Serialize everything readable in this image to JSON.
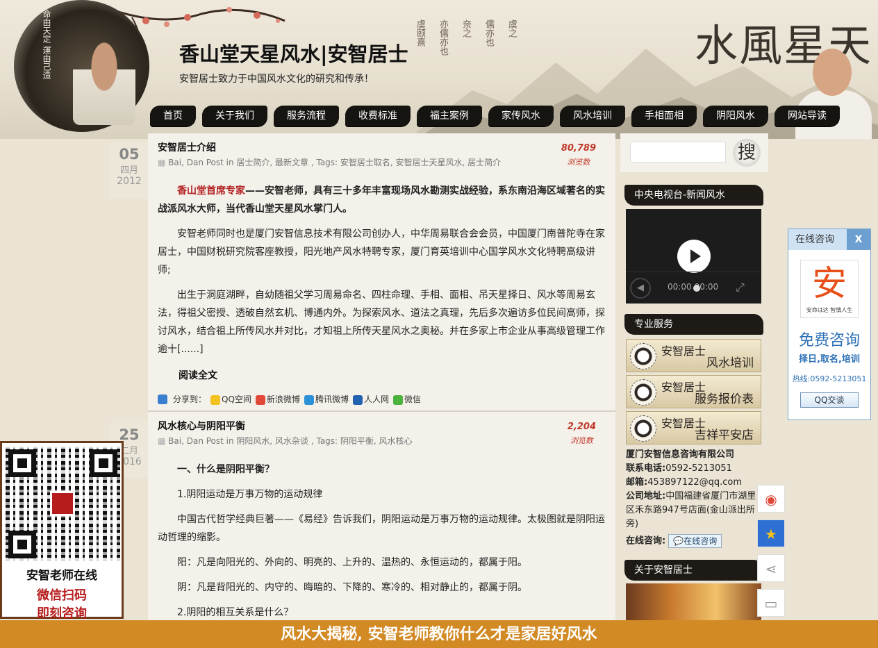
{
  "header": {
    "site_title": "香山堂天星风水|安智居士",
    "site_subtitle": "安智居士致力于中国风水文化的研究和传承！",
    "calligraphy_big": "水風星天",
    "poem_columns": [
      "虞颐熹",
      "亦儒亦也",
      "奈之",
      "儒亦也",
      "虞之"
    ],
    "left_calligraphy": "命由天定 運由己造"
  },
  "nav": {
    "items": [
      "首页",
      "关于我们",
      "服务流程",
      "收费标准",
      "福主案例",
      "家传风水",
      "风水培训",
      "手相面相",
      "阴阳风水",
      "网站导读"
    ]
  },
  "posts": [
    {
      "day": "05",
      "month": "四月",
      "year": "2012",
      "title": "安智居士介绍",
      "meta": "Bai, Dan Post in 居士简介, 最新文章 , Tags: 安智居士取名, 安智居士天星风水, 居士简介",
      "views": "80,789",
      "views_label": "浏览数",
      "lead_red": "香山堂首席专家",
      "lead_rest": "——安智老师，具有三十多年丰富现场风水勘测实战经验，系东南沿海区域著名的实战派风水大师，当代香山堂天星风水掌门人。",
      "p2": "安智老师同时也是厦门安智信息技术有限公司创办人，中华周易联合会会员，中国厦门南普陀寺在家居士，中国财税研究院客座教授，阳光地产风水特聘专家，厦门育英培训中心国学风水文化特聘高级讲师;",
      "p3": "出生于洞庭湖畔，自幼随祖父学习周易命名、四柱命理、手相、面相、吊天星择日、风水等周易玄法，得祖父密授、透破自然玄机、博通内外。为探索风水、道法之真理，先后多次遍访多位民间高师，探讨风水，结合祖上所传风水并对比，才知祖上所传天星风水之奥秘。并在多家上市企业从事高级管理工作逾十[......]",
      "read_more": "阅读全文",
      "share_label": "分享到：",
      "share_items": [
        "QQ空间",
        "新浪微博",
        "腾讯微博",
        "人人网",
        "微信"
      ]
    },
    {
      "day": "25",
      "month": "二月",
      "year": "2016",
      "title": "风水核心与阴阳平衡",
      "meta": "Bai, Dan Post in 阴阳风水, 风水杂谈 , Tags: 阴阳平衡, 风水核心",
      "views": "2,204",
      "views_label": "浏览数",
      "h1": "一、什么是阴阳平衡？",
      "h2": "1.阴阳运动是万事万物的运动规律",
      "p1": "中国古代哲学经典巨著——《易经》告诉我们，阴阳运动是万事万物的运动规律。太极图就是阴阳运动哲理的缩影。",
      "p2": "阳：凡是向阳光的、外向的、明亮的、上升的、温热的、永恒运动的，都属于阳。",
      "p3": "阴：凡是背阳光的、内守的、晦暗的、下降的、寒冷的、相对静止的，都属于阴。",
      "h3": "2.阴阳的相互关系是什么？"
    }
  ],
  "sidebar": {
    "search_placeholder": "",
    "search_button": "搜",
    "video_heading": "中央电视台-新闻风水",
    "video_time": "00:00",
    "video_time2": "00:00",
    "services_heading": "专业服务",
    "services": [
      {
        "name": "安智居士",
        "sub": "风水培训"
      },
      {
        "name": "安智居士",
        "sub": "服务报价表"
      },
      {
        "name": "安智居士",
        "sub": "吉祥平安店"
      }
    ],
    "company_name": "厦门安智信息咨询有限公司",
    "phone_label": "联系电话:",
    "phone": "0592-5213051",
    "email_label": "邮箱:",
    "email": "453897122@qq.com",
    "address_label": "公司地址:",
    "address": "中国福建省厦门市湖里区禾东路947号店面(金山派出所旁)",
    "online_label": "在线咨询:",
    "online_button": "在线咨询",
    "about_heading": "关于安智居士"
  },
  "consult": {
    "title": "在线咨询",
    "close": "X",
    "logo_char": "安",
    "logo_slogan": "安命は达 智慎人生",
    "free": "免费咨询",
    "sub": "择日,取名,培训",
    "hotline": "热线:0592-5213051",
    "qq_button": "QQ交谈"
  },
  "float_icons": [
    "weibo-icon",
    "star-icon",
    "share-icon",
    "chat-icon"
  ],
  "qr": {
    "line1": "安智老师在线",
    "line2": "微信扫码",
    "line3": "即刻咨询"
  },
  "banner": {
    "text": "风水大揭秘, 安智老师教你什么才是家居好风水"
  },
  "colors": {
    "nav_bg": "#161410",
    "accent_red": "#b22222",
    "banner_bg": "#d28a25",
    "consult_blue": "#2c6fb5"
  }
}
